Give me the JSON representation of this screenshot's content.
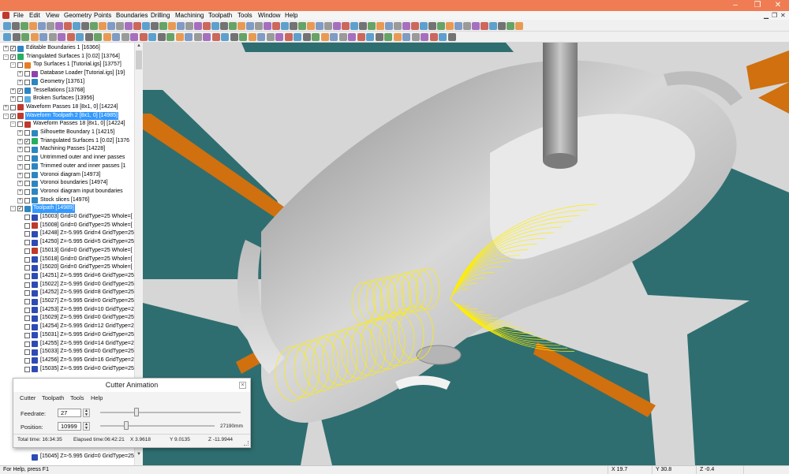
{
  "menubar": {
    "items": [
      "File",
      "Edit",
      "View",
      "Geometry",
      "Points",
      "Boundaries",
      "Drilling",
      "Machining",
      "Toolpath",
      "Tools",
      "Window",
      "Help"
    ]
  },
  "window_controls": {
    "minimize": "–",
    "restore": "❐",
    "close": "✕"
  },
  "tree": {
    "rows": [
      {
        "label": "Editable Boundaries 1 [16366]",
        "indent": 0,
        "expander": "+",
        "checked": true,
        "icon": "boundary-icon",
        "color": "#2e86c1"
      },
      {
        "label": "Triangulated Surfaces 1 [0.02] [13764]",
        "indent": 0,
        "expander": "-",
        "checked": true,
        "icon": "surface-icon",
        "color": "#27ae60"
      },
      {
        "label": "Top Surfaces 1 [Tutorial.igs] [13757]",
        "indent": 1,
        "expander": "-",
        "checked": false,
        "icon": "surface-icon",
        "color": "#e67e22"
      },
      {
        "label": "Database Loader [Tutorial.igs] [19]",
        "indent": 2,
        "expander": "+",
        "checked": false,
        "icon": "database-icon",
        "color": "#8e44ad"
      },
      {
        "label": "Geometry [13761]",
        "indent": 2,
        "expander": "+",
        "checked": false,
        "icon": "geometry-icon",
        "color": "#2e86c1"
      },
      {
        "label": "Tessellations [13768]",
        "indent": 1,
        "expander": "+",
        "checked": true,
        "icon": "tessellation-icon",
        "color": "#2e86c1"
      },
      {
        "label": "Broken Surfaces [13956]",
        "indent": 1,
        "expander": "+",
        "checked": false,
        "icon": "surface-icon",
        "color": "#5dade2"
      },
      {
        "label": "Waveform Passes 18 [8x1, 0] [14224]",
        "indent": 0,
        "expander": "+",
        "checked": false,
        "icon": "toolpath-icon",
        "color": "#c0392b"
      },
      {
        "label": "Waveform Toolpath 2 [8x1, 0] [14985]",
        "indent": 0,
        "expander": "-",
        "checked": true,
        "icon": "toolpath-icon",
        "color": "#c0392b",
        "selected": true
      },
      {
        "label": "Waveform Passes 18 [8x1, 0] [14224]",
        "indent": 1,
        "expander": "-",
        "checked": false,
        "icon": "toolpath-icon",
        "color": "#c0392b"
      },
      {
        "label": "Silhouette Boundary 1 [14215]",
        "indent": 2,
        "expander": "+",
        "checked": false,
        "icon": "boundary-icon",
        "color": "#2e86c1"
      },
      {
        "label": "Triangulated Surfaces 1 [0.02] [1376",
        "indent": 2,
        "expander": "+",
        "checked": true,
        "icon": "surface-icon",
        "color": "#27ae60"
      },
      {
        "label": "Machining Passes [14228]",
        "indent": 2,
        "expander": "+",
        "checked": false,
        "icon": "passes-icon",
        "color": "#2e86c1"
      },
      {
        "label": "Untrimmed outer and inner passes",
        "indent": 2,
        "expander": "+",
        "checked": false,
        "icon": "passes-icon",
        "color": "#2e86c1"
      },
      {
        "label": "Trimmed outer and inner passes [1",
        "indent": 2,
        "expander": "+",
        "checked": false,
        "icon": "passes-icon",
        "color": "#2e86c1"
      },
      {
        "label": "Voronoi diagram [14973]",
        "indent": 2,
        "expander": "+",
        "checked": false,
        "icon": "voronoi-icon",
        "color": "#2e86c1"
      },
      {
        "label": "Voronoi boundaries [14974]",
        "indent": 2,
        "expander": "+",
        "checked": false,
        "icon": "voronoi-icon",
        "color": "#2e86c1"
      },
      {
        "label": "Voronoi diagram input boundaries",
        "indent": 2,
        "expander": "+",
        "checked": false,
        "icon": "voronoi-icon",
        "color": "#2e86c1"
      },
      {
        "label": "Stock slices [14976]",
        "indent": 2,
        "expander": "+",
        "checked": false,
        "icon": "stock-icon",
        "color": "#2e86c1"
      },
      {
        "label": "Toolpath [14989]",
        "indent": 1,
        "expander": "-",
        "checked": true,
        "icon": "toolpath-icon",
        "color": "#2e86c1",
        "selected": true
      },
      {
        "label": "[15003] Grid=0 GridType=25 Whole=[",
        "indent": 2,
        "expander": "",
        "checked": false,
        "icon": "tool-icon",
        "color": "#2e4bb5"
      },
      {
        "label": "[15008] Grid=0 GridType=25 Whole=[",
        "indent": 2,
        "expander": "",
        "checked": false,
        "icon": "tool-icon",
        "color": "#c0392b"
      },
      {
        "label": "[14248] Z=-5.995 Grid=4 GridType=25",
        "indent": 2,
        "expander": "",
        "checked": false,
        "icon": "tool-icon",
        "color": "#2e4bb5"
      },
      {
        "label": "[14250] Z=-5.995 Grid=5 GridType=25",
        "indent": 2,
        "expander": "",
        "checked": false,
        "icon": "tool-icon",
        "color": "#2e4bb5"
      },
      {
        "label": "[15013] Grid=0 GridType=25 Whole=[",
        "indent": 2,
        "expander": "",
        "checked": false,
        "icon": "tool-icon",
        "color": "#c0392b"
      },
      {
        "label": "[15018] Grid=0 GridType=25 Whole=[",
        "indent": 2,
        "expander": "",
        "checked": false,
        "icon": "tool-icon",
        "color": "#2e4bb5"
      },
      {
        "label": "[15020] Grid=0 GridType=25 Whole=[",
        "indent": 2,
        "expander": "",
        "checked": false,
        "icon": "tool-icon",
        "color": "#2e4bb5"
      },
      {
        "label": "[14251] Z=-5.995 Grid=6 GridType=25",
        "indent": 2,
        "expander": "",
        "checked": false,
        "icon": "tool-icon",
        "color": "#2e4bb5"
      },
      {
        "label": "[15022] Z=-5.995 Grid=0 GridType=25",
        "indent": 2,
        "expander": "",
        "checked": false,
        "icon": "tool-icon",
        "color": "#2e4bb5"
      },
      {
        "label": "[14252] Z=-5.995 Grid=8 GridType=25",
        "indent": 2,
        "expander": "",
        "checked": false,
        "icon": "tool-icon",
        "color": "#2e4bb5"
      },
      {
        "label": "[15027] Z=-5.995 Grid=0 GridType=25",
        "indent": 2,
        "expander": "",
        "checked": false,
        "icon": "tool-icon",
        "color": "#2e4bb5"
      },
      {
        "label": "[14253] Z=-5.995 Grid=10 GridType=2",
        "indent": 2,
        "expander": "",
        "checked": false,
        "icon": "tool-icon",
        "color": "#2e4bb5"
      },
      {
        "label": "[15029] Z=-5.995 Grid=0 GridType=25",
        "indent": 2,
        "expander": "",
        "checked": false,
        "icon": "tool-icon",
        "color": "#2e4bb5"
      },
      {
        "label": "[14254] Z=-5.995 Grid=12 GridType=2",
        "indent": 2,
        "expander": "",
        "checked": false,
        "icon": "tool-icon",
        "color": "#2e4bb5"
      },
      {
        "label": "[15031] Z=-5.995 Grid=0 GridType=25",
        "indent": 2,
        "expander": "",
        "checked": false,
        "icon": "tool-icon",
        "color": "#2e4bb5"
      },
      {
        "label": "[14255] Z=-5.995 Grid=14 GridType=2",
        "indent": 2,
        "expander": "",
        "checked": false,
        "icon": "tool-icon",
        "color": "#2e4bb5"
      },
      {
        "label": "[15033] Z=-5.995 Grid=0 GridType=25",
        "indent": 2,
        "expander": "",
        "checked": false,
        "icon": "tool-icon",
        "color": "#2e4bb5"
      },
      {
        "label": "[14256] Z=-5.995 Grid=16 GridType=2",
        "indent": 2,
        "expander": "",
        "checked": false,
        "icon": "tool-icon",
        "color": "#2e4bb5"
      },
      {
        "label": "[15035] Z=-5.995 Grid=0 GridType=25",
        "indent": 2,
        "expander": "",
        "checked": false,
        "icon": "tool-icon",
        "color": "#2e4bb5"
      }
    ],
    "last_row": "[15045] Z=-5.995 Grid=0 GridType=25"
  },
  "dialog": {
    "title": "Cutter Animation",
    "close": "×",
    "menu": [
      "Cutter",
      "Toolpath",
      "Tools",
      "Help"
    ],
    "feedrate_label": "Feedrate:",
    "feedrate_value": "27",
    "position_label": "Position:",
    "position_value": "10999",
    "position_distance": "27190mm",
    "total_time": "Total time: 16:34:35",
    "elapsed_time": "Elapsed time:06:42:21",
    "x_readout": "X  3.9618",
    "y_readout": "Y  9.0135",
    "z_readout": "Z  -11.9944",
    "feedrate_slider_fraction": 0.24,
    "position_slider_fraction": 0.21
  },
  "statusbar": {
    "help": "For Help, press F1",
    "x": "X 19.7",
    "y": "Y 30.8",
    "z": "Z -0.4"
  },
  "colors": {
    "titlebar": "#ef7c52",
    "selection": "#3399ff",
    "stock_teal": "#2f6e70",
    "accent_orange": "#d0700f",
    "toolpath_yellow": "#ffee00",
    "part_gray": "#cfcfcf"
  }
}
